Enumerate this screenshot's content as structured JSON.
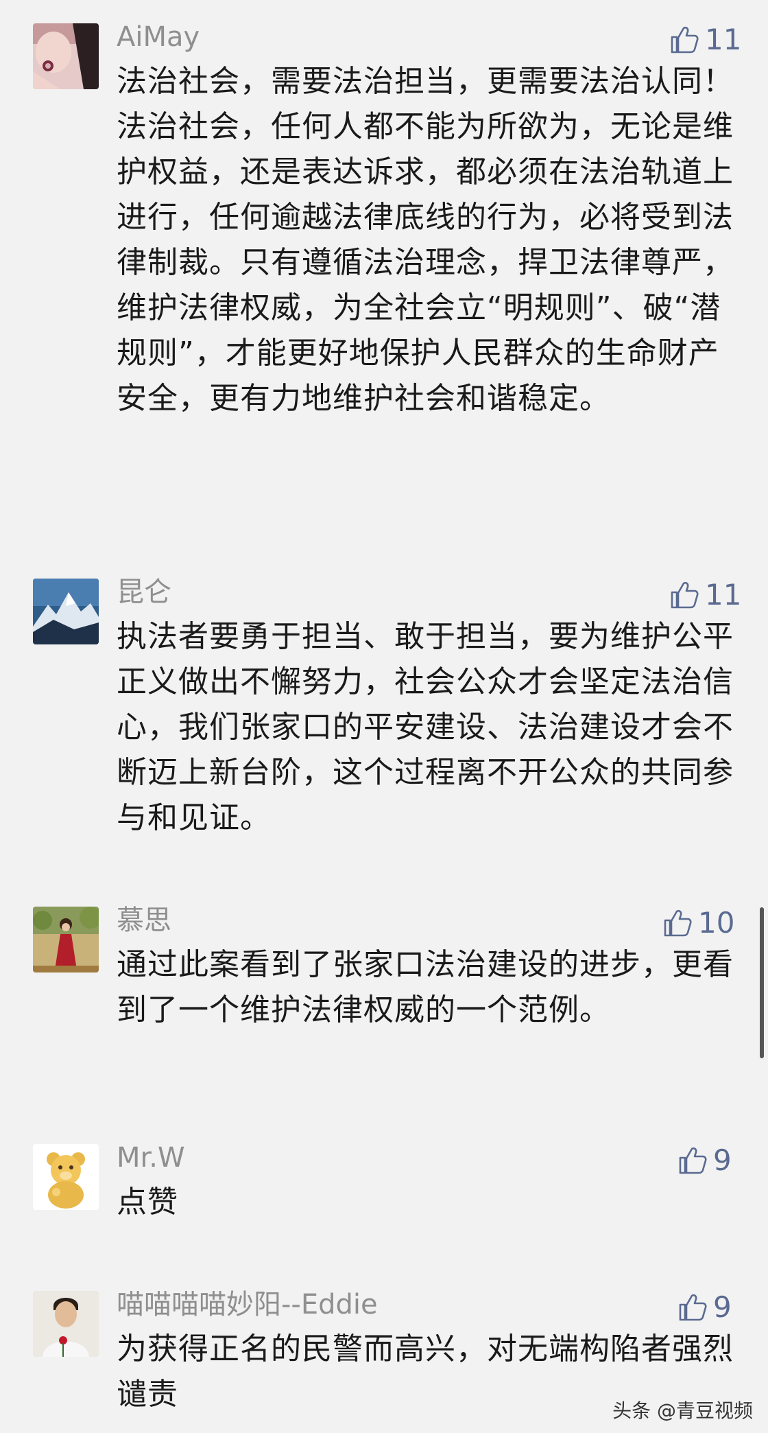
{
  "comments": [
    {
      "username": "AiMay",
      "likes": "11",
      "avatar_icon": "woman-portrait-avatar",
      "text": "法治社会，需要法治担当，更需要法治认同！法治社会，任何人都不能为所欲为，无论是维护权益，还是表达诉求，都必须在法治轨道上进行，任何逾越法律底线的行为，必将受到法律制裁。只有遵循法治理念，捍卫法律尊严，维护法律权威，为全社会立“明规则”、破“潜规则”，才能更好地保护人民群众的生命财产安全，更有力地维护社会和谐稳定。"
    },
    {
      "username": "昆仑",
      "likes": "11",
      "avatar_icon": "mountain-landscape-avatar",
      "text": "执法者要勇于担当、敢于担当，要为维护公平正义做出不懈努力，社会公众才会坚定法治信心，我们张家口的平安建设、法治建设才会不断迈上新台阶，这个过程离不开公众的共同参与和见证。"
    },
    {
      "username": "慕思",
      "likes": "10",
      "avatar_icon": "woman-red-dress-avatar",
      "text": "通过此案看到了张家口法治建设的进步，更看到了一个维护法律权威的一个范例。"
    },
    {
      "username": "Mr.W",
      "likes": "9",
      "avatar_icon": "bear-cartoon-avatar",
      "text": "点赞"
    },
    {
      "username": "喵喵喵喵妙阳--Eddie",
      "likes": "9",
      "avatar_icon": "man-with-rose-avatar",
      "text": "为获得正名的民警而高兴，对无端构陷者强烈谴责"
    }
  ],
  "watermark": "头条 @青豆视频",
  "colors": {
    "background": "#f2f2f2",
    "username": "#8f8f8f",
    "like": "#5a6a90",
    "text": "#1a1a1a"
  }
}
